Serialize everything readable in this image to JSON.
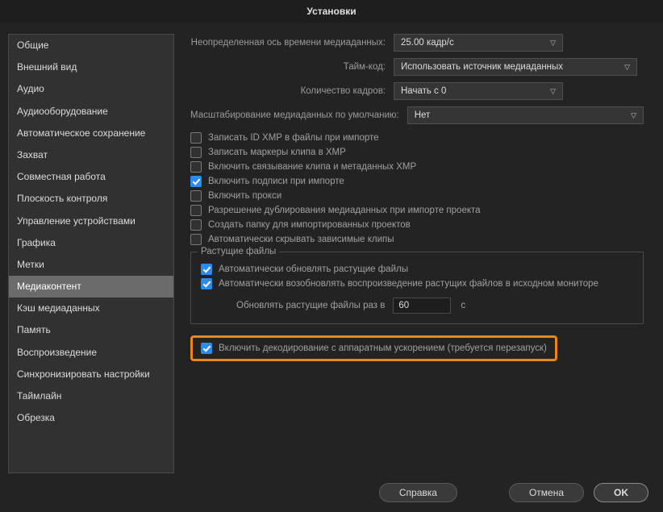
{
  "title": "Установки",
  "sidebar": {
    "items": [
      "Общие",
      "Внешний вид",
      "Аудио",
      "Аудиооборудование",
      "Автоматическое сохранение",
      "Захват",
      "Совместная работа",
      "Плоскость контроля",
      "Управление устройствами",
      "Графика",
      "Метки",
      "Медиаконтент",
      "Кэш медиаданных",
      "Память",
      "Воспроизведение",
      "Синхронизировать настройки",
      "Таймлайн",
      "Обрезка"
    ],
    "selected_index": 11
  },
  "rows": {
    "timebase": {
      "label": "Неопределенная ось времени медиаданных:",
      "value": "25.00 кадр/с"
    },
    "timecode": {
      "label": "Тайм-код:",
      "value": "Использовать источник медиаданных"
    },
    "framecount": {
      "label": "Количество кадров:",
      "value": "Начать с 0"
    },
    "scaling": {
      "label": "Масштабирование медиаданных по умолчанию:",
      "value": "Нет"
    }
  },
  "checks": {
    "write_xmp": "Записать ID XMP в файлы при импорте",
    "write_markers": "Записать маркеры клипа в XMP",
    "link_meta": "Включить связывание клипа и метаданных XMP",
    "captions_import": "Включить подписи при импорте",
    "proxy": "Включить прокси",
    "dup_media": "Разрешение дублирования медиаданных при импорте проекта",
    "create_folder": "Создать папку для импортированных проектов",
    "hide_deps": "Автоматически скрывать зависимые клипы"
  },
  "growing": {
    "legend": "Растущие файлы",
    "auto_refresh": "Автоматически обновлять растущие файлы",
    "auto_reload": "Автоматически возобновлять воспроизведение растущих файлов в исходном мониторе",
    "interval_label": "Обновлять растущие файлы раз в",
    "interval_value": "60",
    "interval_unit": "с"
  },
  "hw_decode": "Включить декодирование с аппаратным ускорением (требуется перезапуск)",
  "buttons": {
    "help": "Справка",
    "cancel": "Отмена",
    "ok": "OK"
  }
}
